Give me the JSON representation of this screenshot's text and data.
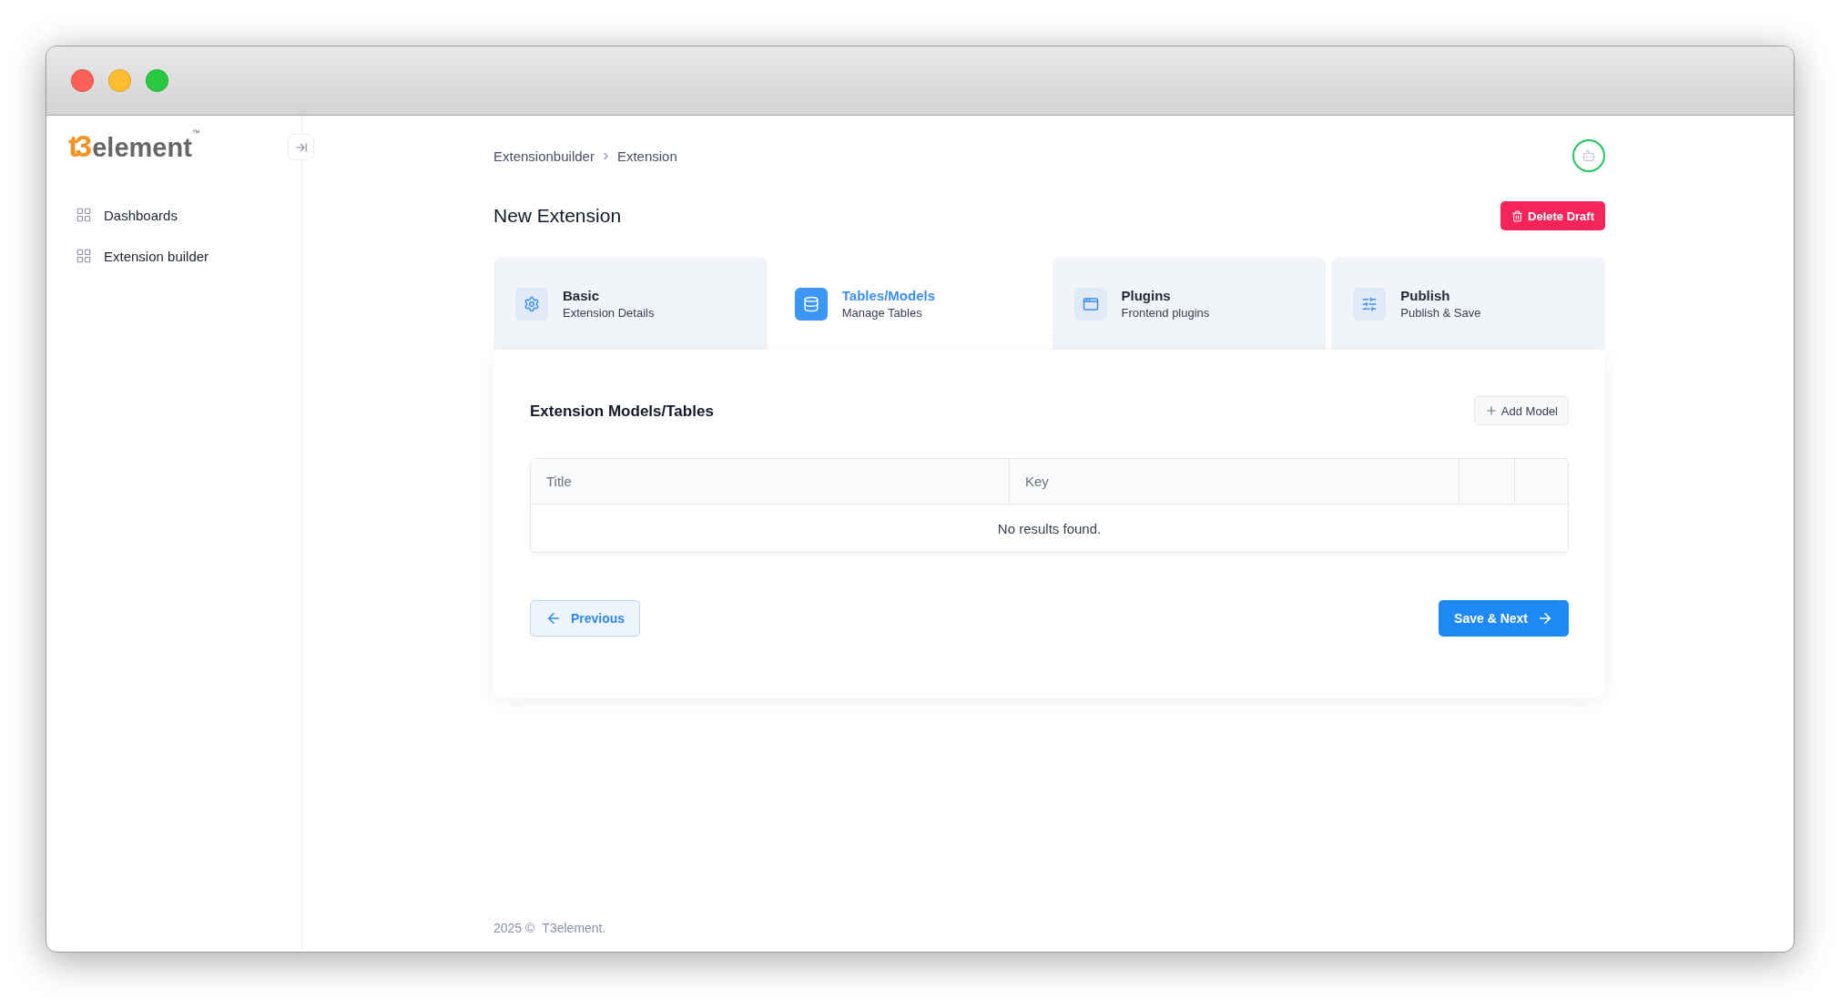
{
  "logo": {
    "mark": "t3",
    "name": "element",
    "trademark": "™"
  },
  "sidebar": {
    "items": [
      {
        "label": "Dashboards"
      },
      {
        "label": "Extension builder"
      }
    ]
  },
  "breadcrumb": [
    "Extensionbuilder",
    "Extension"
  ],
  "page": {
    "title": "New Extension",
    "delete_button": "Delete Draft"
  },
  "tabs": [
    {
      "title": "Basic",
      "subtitle": "Extension Details",
      "selected": false
    },
    {
      "title": "Tables/Models",
      "subtitle": "Manage Tables",
      "selected": true
    },
    {
      "title": "Plugins",
      "subtitle": "Frontend plugins",
      "selected": false
    },
    {
      "title": "Publish",
      "subtitle": "Publish & Save",
      "selected": false
    }
  ],
  "card": {
    "heading": "Extension Models/Tables",
    "add_button": "Add Model",
    "table": {
      "columns": [
        "Title",
        "Key"
      ],
      "empty_message": "No results found."
    },
    "previous_button": "Previous",
    "next_button": "Save & Next"
  },
  "footer": {
    "year": "2025 ©",
    "brand": "T3element."
  }
}
